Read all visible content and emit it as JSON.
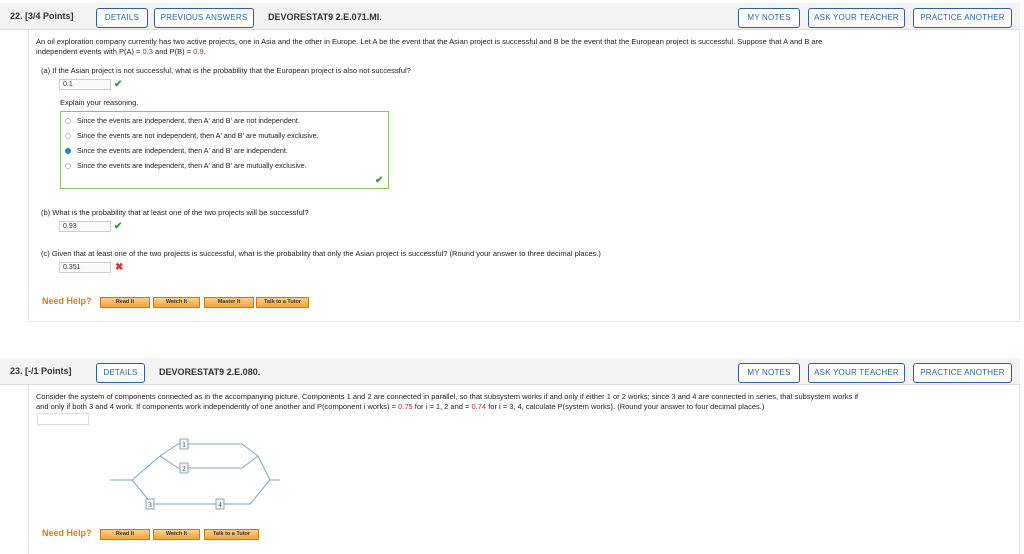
{
  "q22": {
    "number": "22.",
    "points": "[3/4 Points]",
    "details": "DETAILS",
    "previous_answers": "PREVIOUS ANSWERS",
    "code": "DEVORESTAT9 2.E.071.MI.",
    "my_notes": "MY NOTES",
    "ask_teacher": "ASK YOUR TEACHER",
    "practice_another": "PRACTICE ANOTHER",
    "intro_1": "An oil exploration company currently has two active projects, one in Asia and the other in Europe. Let A be the event that the Asian project is successful and B be the event that the European project is successful. Suppose that A and B are",
    "intro_2a": "independent events with P(A) = ",
    "pa": "0.3",
    "intro_2b": " and P(B) = ",
    "pb": "0.9",
    "intro_2c": ".",
    "part_a": "(a)   If the Asian project is not successful, what is the probability that the European project is also not successful?",
    "answer_a": "0.1",
    "explain": "Explain your reasoning.",
    "options": [
      "Since the events are independent, then A′ and B′ are not independent.",
      "Since the events are not independent, then A′ and B′ are mutually exclusive.",
      "Since the events are independent, then A′ and B′ are independent.",
      "Since the events are independent, then A′ and B′ are mutually exclusive."
    ],
    "selected_option": 2,
    "part_b": "(b)   What is the probability that at least one of the two projects will be successful?",
    "answer_b": "0.93",
    "part_c": "(c)   Given that at least one of the two projects is successful, what is the probability that only the Asian project is successful? (Round your answer to three decimal places.)",
    "answer_c": "0.351",
    "need_help": "Need Help?",
    "help_buttons": [
      "Read It",
      "Watch It",
      "Master It",
      "Talk to a Tutor"
    ]
  },
  "q23": {
    "number": "23.",
    "points": "[-/1 Points]",
    "details": "DETAILS",
    "code": "DEVORESTAT9 2.E.080.",
    "my_notes": "MY NOTES",
    "ask_teacher": "ASK YOUR TEACHER",
    "practice_another": "PRACTICE ANOTHER",
    "intro_1": "Consider the system of components connected as in the accompanying picture. Components 1 and 2 are connected in parallel, so that subsystem works if and only if either 1 or 2 works; since 3 and 4 are connected in series, that subsystem works if",
    "intro_2a": "and only if both 3 and 4 work. If components work independently of one another and P(component i works) = ",
    "p12": "0.75",
    "intro_2b": " for i = 1, 2 and = ",
    "p34": "0.74",
    "intro_2c": " for i = 3, 4, calculate P(system works). (Round your answer to four decimal places.)",
    "answer": "",
    "diagram_labels": [
      "1",
      "2",
      "3",
      "4"
    ],
    "need_help": "Need Help?",
    "help_buttons": [
      "Read It",
      "Watch It",
      "Talk to a Tutor"
    ]
  },
  "colors": {
    "link_blue": "#2e5f9e",
    "correct_green": "#3a9a3a",
    "wrong_red": "#dd3333",
    "help_orange": "#d08020"
  }
}
